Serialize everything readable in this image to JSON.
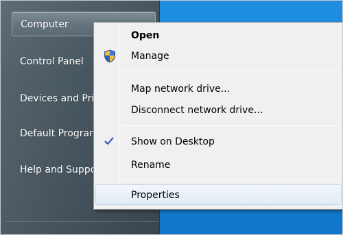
{
  "start_menu": {
    "items": [
      {
        "label": "Computer"
      },
      {
        "label": "Control Panel"
      },
      {
        "label": "Devices and Printers"
      },
      {
        "label": "Default Programs"
      },
      {
        "label": "Help and Support"
      }
    ]
  },
  "context_menu": {
    "items": [
      {
        "label": "Open",
        "bold": true
      },
      {
        "label": "Manage",
        "icon": "uac-shield-icon"
      },
      {
        "label": "Map network drive..."
      },
      {
        "label": "Disconnect network drive..."
      },
      {
        "label": "Show on Desktop",
        "checked": true,
        "icon": "checkmark-icon"
      },
      {
        "label": "Rename"
      },
      {
        "label": "Properties",
        "highlighted": true
      }
    ]
  },
  "colors": {
    "desktop_blue": "#1682d6",
    "start_pane": "#4a5862",
    "menu_background": "#f0f0f0",
    "check_blue": "#1c4fb5"
  }
}
